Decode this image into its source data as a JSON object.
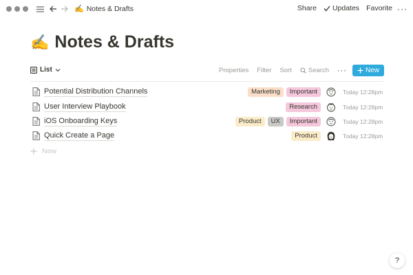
{
  "topbar": {
    "page_emoji": "✍️",
    "breadcrumb": "Notes & Drafts",
    "share": "Share",
    "updates": "Updates",
    "favorite": "Favorite"
  },
  "page": {
    "emoji": "✍️",
    "title": "Notes & Drafts"
  },
  "view": {
    "name": "List",
    "tools": {
      "properties": "Properties",
      "filter": "Filter",
      "sort": "Sort",
      "search": "Search",
      "more": "···",
      "new": "New"
    }
  },
  "rows": [
    {
      "name": "Potential Distribution Channels",
      "tags": [
        {
          "label": "Marketing",
          "color": "#fadec9"
        },
        {
          "label": "Important",
          "color": "#f5c7db"
        }
      ],
      "avatar": "face-a",
      "date": "Today 12:28pm"
    },
    {
      "name": "User Interview Playbook",
      "tags": [
        {
          "label": "Research",
          "color": "#f5c7db"
        }
      ],
      "avatar": "face-b",
      "date": "Today 12:28pm"
    },
    {
      "name": "iOS Onboarding Keys",
      "tags": [
        {
          "label": "Product",
          "color": "#fbecc9"
        },
        {
          "label": "UX",
          "color": "#c9c9c7"
        },
        {
          "label": "Important",
          "color": "#f5c7db"
        }
      ],
      "avatar": "face-a",
      "date": "Today 12:28pm"
    },
    {
      "name": "Quick Create a Page",
      "tags": [
        {
          "label": "Product",
          "color": "#fbecc9"
        }
      ],
      "avatar": "face-c",
      "date": "Today 12:28pm"
    }
  ],
  "new_row": "New",
  "help": "?",
  "colors": {
    "accent": "#2eaadc",
    "text": "#37352f",
    "muted": "#9b9a97"
  }
}
